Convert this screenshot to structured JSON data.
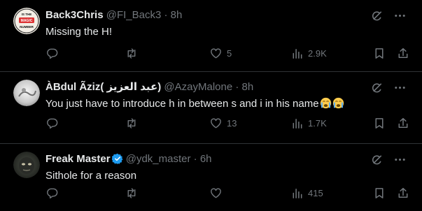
{
  "tweets": [
    {
      "name": "Back3Chris",
      "handle": "@FI_Back3",
      "sep": "·",
      "time": "8h",
      "text": "Missing the H!",
      "avatar_text": "IS THE MAGIC NUMBER",
      "likes": "5",
      "views": "2.9K",
      "retweets": "",
      "replies": ""
    },
    {
      "name": "ÀBdul Ãziz( عبد العزيز)",
      "handle": "@AzayMalone",
      "sep": "·",
      "time": "8h",
      "text": "You just have to introduce h in between s and i in his name",
      "likes": "13",
      "views": "1.7K",
      "retweets": "",
      "replies": ""
    },
    {
      "name": "Freak Master",
      "handle": "@ydk_master",
      "sep": "·",
      "time": "6h",
      "text": "Sithole for a reason",
      "likes": "",
      "views": "415",
      "retweets": "",
      "replies": "",
      "verified": true
    }
  ],
  "icons": {
    "grok": "grok-icon",
    "more": "more-icon",
    "reply": "reply-icon",
    "retweet": "retweet-icon",
    "like": "heart-icon",
    "views": "views-icon",
    "bookmark": "bookmark-icon",
    "share": "share-icon"
  },
  "colors": {
    "background": "#000000",
    "text": "#e7e9ea",
    "muted": "#71767b",
    "divider": "#2f3336",
    "verified": "#1d9bf0"
  }
}
